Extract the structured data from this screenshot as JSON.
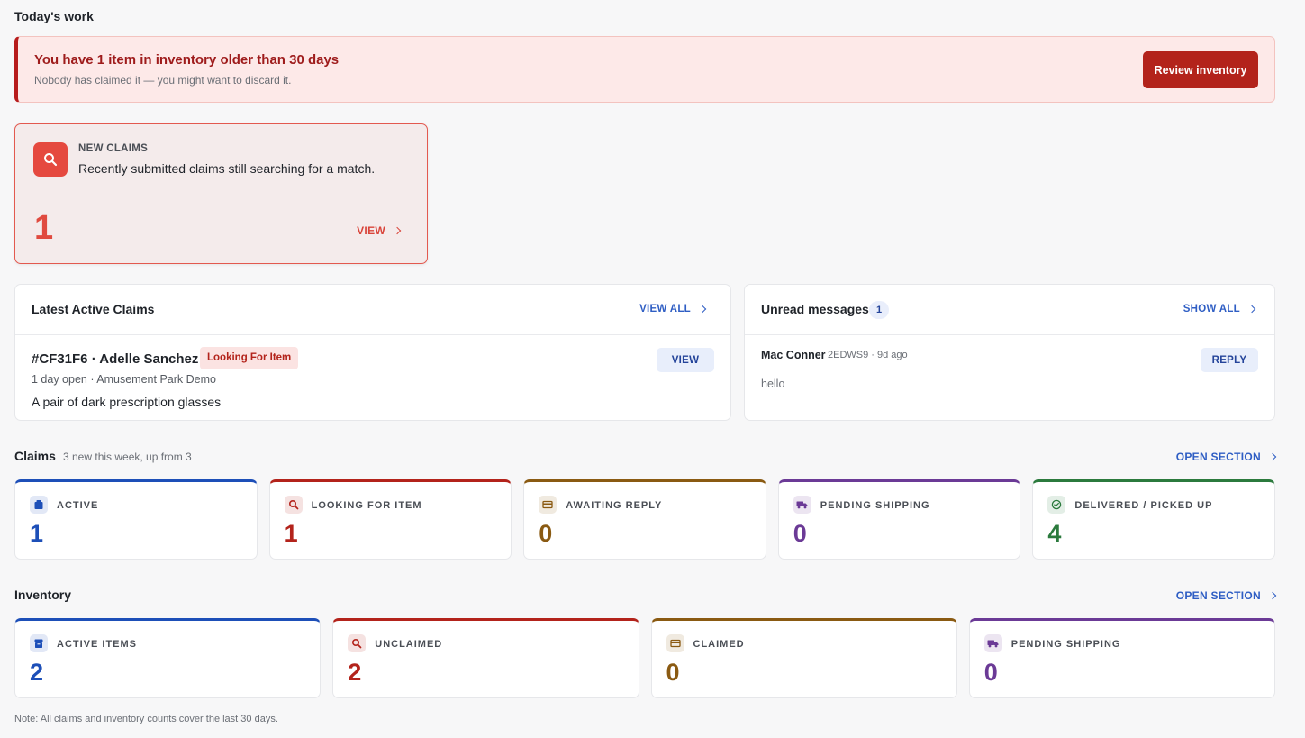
{
  "page_title": "Today's work",
  "alert": {
    "title": "You have 1 item in inventory older than 30 days",
    "subtitle": "Nobody has claimed it — you might want to discard it.",
    "button": "Review inventory"
  },
  "new_claims": {
    "label": "NEW CLAIMS",
    "description": "Recently submitted claims still searching for a match.",
    "count": "1",
    "view": "VIEW"
  },
  "latest_claims": {
    "title": "Latest Active Claims",
    "view_all": "VIEW ALL",
    "item": {
      "id_name": "#CF31F6 · Adelle Sanchez",
      "badge": "Looking For Item",
      "meta": "1 day open · Amusement Park Demo",
      "description": "A pair of dark prescription glasses",
      "button": "VIEW"
    }
  },
  "unread": {
    "title": "Unread messages",
    "count": "1",
    "show_all": "SHOW ALL",
    "message": {
      "from": "Mac Conner",
      "meta": "2EDWS9 · 9d ago",
      "body": "hello",
      "button": "REPLY"
    }
  },
  "claims": {
    "title": "Claims",
    "subtitle": "3 new this week, up from 3",
    "open_section": "OPEN SECTION",
    "stats": [
      {
        "label": "ACTIVE",
        "value": "1",
        "color": "#1d4fb8",
        "icon": "clipboard-icon"
      },
      {
        "label": "LOOKING FOR ITEM",
        "value": "1",
        "color": "#b3231b",
        "icon": "search-icon"
      },
      {
        "label": "AWAITING REPLY",
        "value": "0",
        "color": "#8a5a12",
        "icon": "card-icon"
      },
      {
        "label": "PENDING SHIPPING",
        "value": "0",
        "color": "#6b3a96",
        "icon": "truck-icon"
      },
      {
        "label": "DELIVERED / PICKED UP",
        "value": "4",
        "color": "#2b7a3d",
        "icon": "check-circle-icon"
      }
    ]
  },
  "inventory": {
    "title": "Inventory",
    "open_section": "OPEN SECTION",
    "stats": [
      {
        "label": "ACTIVE ITEMS",
        "value": "2",
        "color": "#1d4fb8",
        "icon": "box-icon"
      },
      {
        "label": "UNCLAIMED",
        "value": "2",
        "color": "#b3231b",
        "icon": "search-icon"
      },
      {
        "label": "CLAIMED",
        "value": "0",
        "color": "#8a5a12",
        "icon": "card-icon"
      },
      {
        "label": "PENDING SHIPPING",
        "value": "0",
        "color": "#6b3a96",
        "icon": "truck-icon"
      }
    ]
  },
  "footnote": "Note: All claims and inventory counts cover the last 30 days."
}
